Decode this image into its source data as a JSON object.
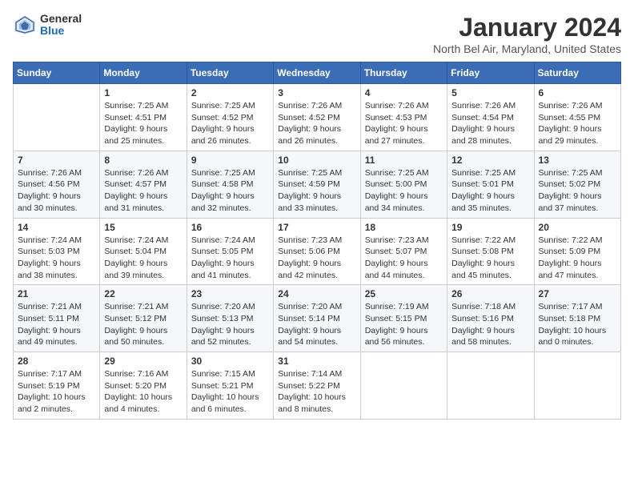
{
  "logo": {
    "general": "General",
    "blue": "Blue"
  },
  "title": "January 2024",
  "location": "North Bel Air, Maryland, United States",
  "days_header": [
    "Sunday",
    "Monday",
    "Tuesday",
    "Wednesday",
    "Thursday",
    "Friday",
    "Saturday"
  ],
  "weeks": [
    [
      {
        "day": "",
        "sunrise": "",
        "sunset": "",
        "daylight": ""
      },
      {
        "day": "1",
        "sunrise": "Sunrise: 7:25 AM",
        "sunset": "Sunset: 4:51 PM",
        "daylight": "Daylight: 9 hours and 25 minutes."
      },
      {
        "day": "2",
        "sunrise": "Sunrise: 7:25 AM",
        "sunset": "Sunset: 4:52 PM",
        "daylight": "Daylight: 9 hours and 26 minutes."
      },
      {
        "day": "3",
        "sunrise": "Sunrise: 7:26 AM",
        "sunset": "Sunset: 4:52 PM",
        "daylight": "Daylight: 9 hours and 26 minutes."
      },
      {
        "day": "4",
        "sunrise": "Sunrise: 7:26 AM",
        "sunset": "Sunset: 4:53 PM",
        "daylight": "Daylight: 9 hours and 27 minutes."
      },
      {
        "day": "5",
        "sunrise": "Sunrise: 7:26 AM",
        "sunset": "Sunset: 4:54 PM",
        "daylight": "Daylight: 9 hours and 28 minutes."
      },
      {
        "day": "6",
        "sunrise": "Sunrise: 7:26 AM",
        "sunset": "Sunset: 4:55 PM",
        "daylight": "Daylight: 9 hours and 29 minutes."
      }
    ],
    [
      {
        "day": "7",
        "sunrise": "Sunrise: 7:26 AM",
        "sunset": "Sunset: 4:56 PM",
        "daylight": "Daylight: 9 hours and 30 minutes."
      },
      {
        "day": "8",
        "sunrise": "Sunrise: 7:26 AM",
        "sunset": "Sunset: 4:57 PM",
        "daylight": "Daylight: 9 hours and 31 minutes."
      },
      {
        "day": "9",
        "sunrise": "Sunrise: 7:25 AM",
        "sunset": "Sunset: 4:58 PM",
        "daylight": "Daylight: 9 hours and 32 minutes."
      },
      {
        "day": "10",
        "sunrise": "Sunrise: 7:25 AM",
        "sunset": "Sunset: 4:59 PM",
        "daylight": "Daylight: 9 hours and 33 minutes."
      },
      {
        "day": "11",
        "sunrise": "Sunrise: 7:25 AM",
        "sunset": "Sunset: 5:00 PM",
        "daylight": "Daylight: 9 hours and 34 minutes."
      },
      {
        "day": "12",
        "sunrise": "Sunrise: 7:25 AM",
        "sunset": "Sunset: 5:01 PM",
        "daylight": "Daylight: 9 hours and 35 minutes."
      },
      {
        "day": "13",
        "sunrise": "Sunrise: 7:25 AM",
        "sunset": "Sunset: 5:02 PM",
        "daylight": "Daylight: 9 hours and 37 minutes."
      }
    ],
    [
      {
        "day": "14",
        "sunrise": "Sunrise: 7:24 AM",
        "sunset": "Sunset: 5:03 PM",
        "daylight": "Daylight: 9 hours and 38 minutes."
      },
      {
        "day": "15",
        "sunrise": "Sunrise: 7:24 AM",
        "sunset": "Sunset: 5:04 PM",
        "daylight": "Daylight: 9 hours and 39 minutes."
      },
      {
        "day": "16",
        "sunrise": "Sunrise: 7:24 AM",
        "sunset": "Sunset: 5:05 PM",
        "daylight": "Daylight: 9 hours and 41 minutes."
      },
      {
        "day": "17",
        "sunrise": "Sunrise: 7:23 AM",
        "sunset": "Sunset: 5:06 PM",
        "daylight": "Daylight: 9 hours and 42 minutes."
      },
      {
        "day": "18",
        "sunrise": "Sunrise: 7:23 AM",
        "sunset": "Sunset: 5:07 PM",
        "daylight": "Daylight: 9 hours and 44 minutes."
      },
      {
        "day": "19",
        "sunrise": "Sunrise: 7:22 AM",
        "sunset": "Sunset: 5:08 PM",
        "daylight": "Daylight: 9 hours and 45 minutes."
      },
      {
        "day": "20",
        "sunrise": "Sunrise: 7:22 AM",
        "sunset": "Sunset: 5:09 PM",
        "daylight": "Daylight: 9 hours and 47 minutes."
      }
    ],
    [
      {
        "day": "21",
        "sunrise": "Sunrise: 7:21 AM",
        "sunset": "Sunset: 5:11 PM",
        "daylight": "Daylight: 9 hours and 49 minutes."
      },
      {
        "day": "22",
        "sunrise": "Sunrise: 7:21 AM",
        "sunset": "Sunset: 5:12 PM",
        "daylight": "Daylight: 9 hours and 50 minutes."
      },
      {
        "day": "23",
        "sunrise": "Sunrise: 7:20 AM",
        "sunset": "Sunset: 5:13 PM",
        "daylight": "Daylight: 9 hours and 52 minutes."
      },
      {
        "day": "24",
        "sunrise": "Sunrise: 7:20 AM",
        "sunset": "Sunset: 5:14 PM",
        "daylight": "Daylight: 9 hours and 54 minutes."
      },
      {
        "day": "25",
        "sunrise": "Sunrise: 7:19 AM",
        "sunset": "Sunset: 5:15 PM",
        "daylight": "Daylight: 9 hours and 56 minutes."
      },
      {
        "day": "26",
        "sunrise": "Sunrise: 7:18 AM",
        "sunset": "Sunset: 5:16 PM",
        "daylight": "Daylight: 9 hours and 58 minutes."
      },
      {
        "day": "27",
        "sunrise": "Sunrise: 7:17 AM",
        "sunset": "Sunset: 5:18 PM",
        "daylight": "Daylight: 10 hours and 0 minutes."
      }
    ],
    [
      {
        "day": "28",
        "sunrise": "Sunrise: 7:17 AM",
        "sunset": "Sunset: 5:19 PM",
        "daylight": "Daylight: 10 hours and 2 minutes."
      },
      {
        "day": "29",
        "sunrise": "Sunrise: 7:16 AM",
        "sunset": "Sunset: 5:20 PM",
        "daylight": "Daylight: 10 hours and 4 minutes."
      },
      {
        "day": "30",
        "sunrise": "Sunrise: 7:15 AM",
        "sunset": "Sunset: 5:21 PM",
        "daylight": "Daylight: 10 hours and 6 minutes."
      },
      {
        "day": "31",
        "sunrise": "Sunrise: 7:14 AM",
        "sunset": "Sunset: 5:22 PM",
        "daylight": "Daylight: 10 hours and 8 minutes."
      },
      {
        "day": "",
        "sunrise": "",
        "sunset": "",
        "daylight": ""
      },
      {
        "day": "",
        "sunrise": "",
        "sunset": "",
        "daylight": ""
      },
      {
        "day": "",
        "sunrise": "",
        "sunset": "",
        "daylight": ""
      }
    ]
  ]
}
